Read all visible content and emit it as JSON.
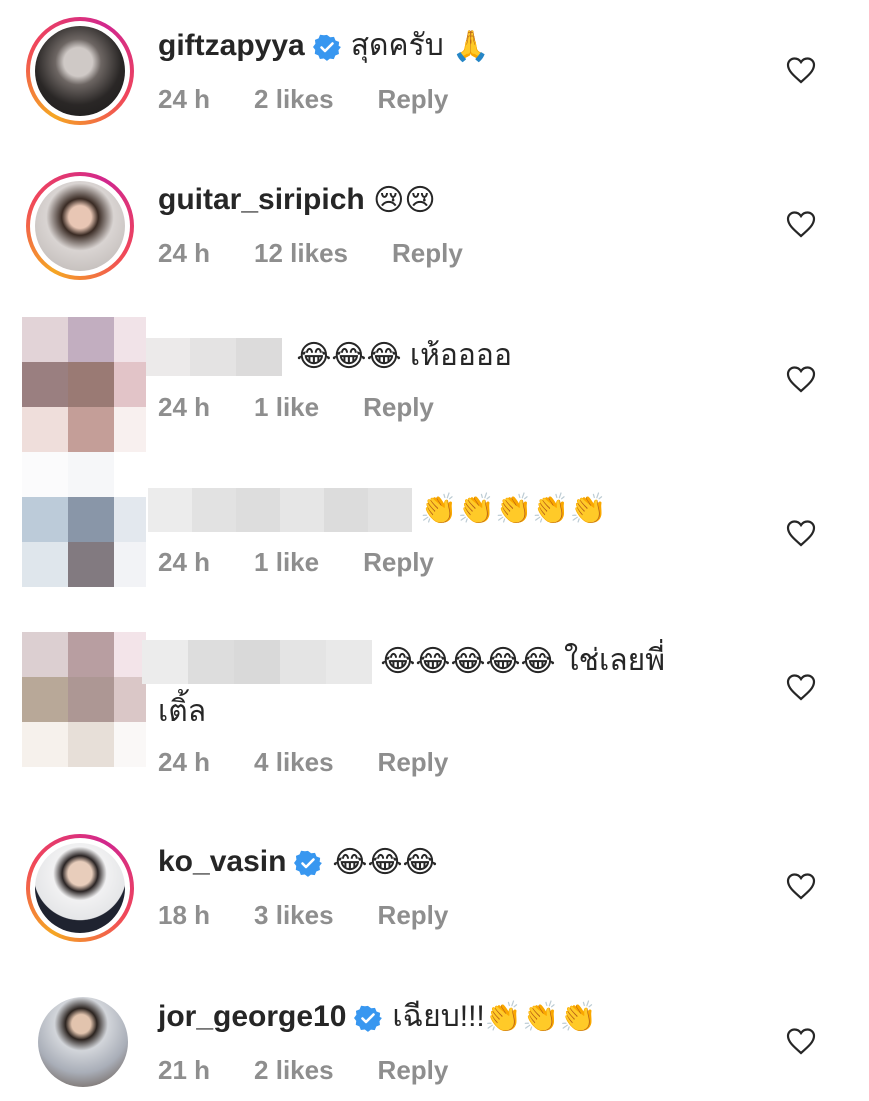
{
  "comments": [
    {
      "username": "giftzapyya",
      "verified": true,
      "text": "สุดครับ",
      "emoji": "🙏",
      "time": "24 h",
      "likes": "2 likes",
      "reply": "Reply"
    },
    {
      "username": "guitar_siripich",
      "verified": false,
      "text": "",
      "emoji": "😢😢",
      "time": "24 h",
      "likes": "12 likes",
      "reply": "Reply"
    },
    {
      "username": "",
      "verified": false,
      "text": "เห้ออออ",
      "emoji": "😂😂😂",
      "time": "24 h",
      "likes": "1 like",
      "reply": "Reply"
    },
    {
      "username": "",
      "verified": false,
      "text": "",
      "emoji": "👏👏👏👏👏",
      "time": "24 h",
      "likes": "1 like",
      "reply": "Reply"
    },
    {
      "username": "",
      "verified": false,
      "text": "ใช่เลยพี่",
      "text_line2": "เติ้ล",
      "emoji": "😂😂😂😂😂",
      "time": "24 h",
      "likes": "4 likes",
      "reply": "Reply"
    },
    {
      "username": "ko_vasin",
      "verified": true,
      "text": "",
      "emoji": "😂😂😂",
      "time": "18 h",
      "likes": "3 likes",
      "reply": "Reply"
    },
    {
      "username": "jor_george10",
      "verified": true,
      "text": "เฉียบ!!!",
      "emoji": "👏👏👏",
      "time": "21 h",
      "likes": "2 likes",
      "reply": "Reply"
    }
  ],
  "colors": {
    "verified": "#3897f0",
    "meta": "#8e8e8e",
    "text": "#262626"
  }
}
